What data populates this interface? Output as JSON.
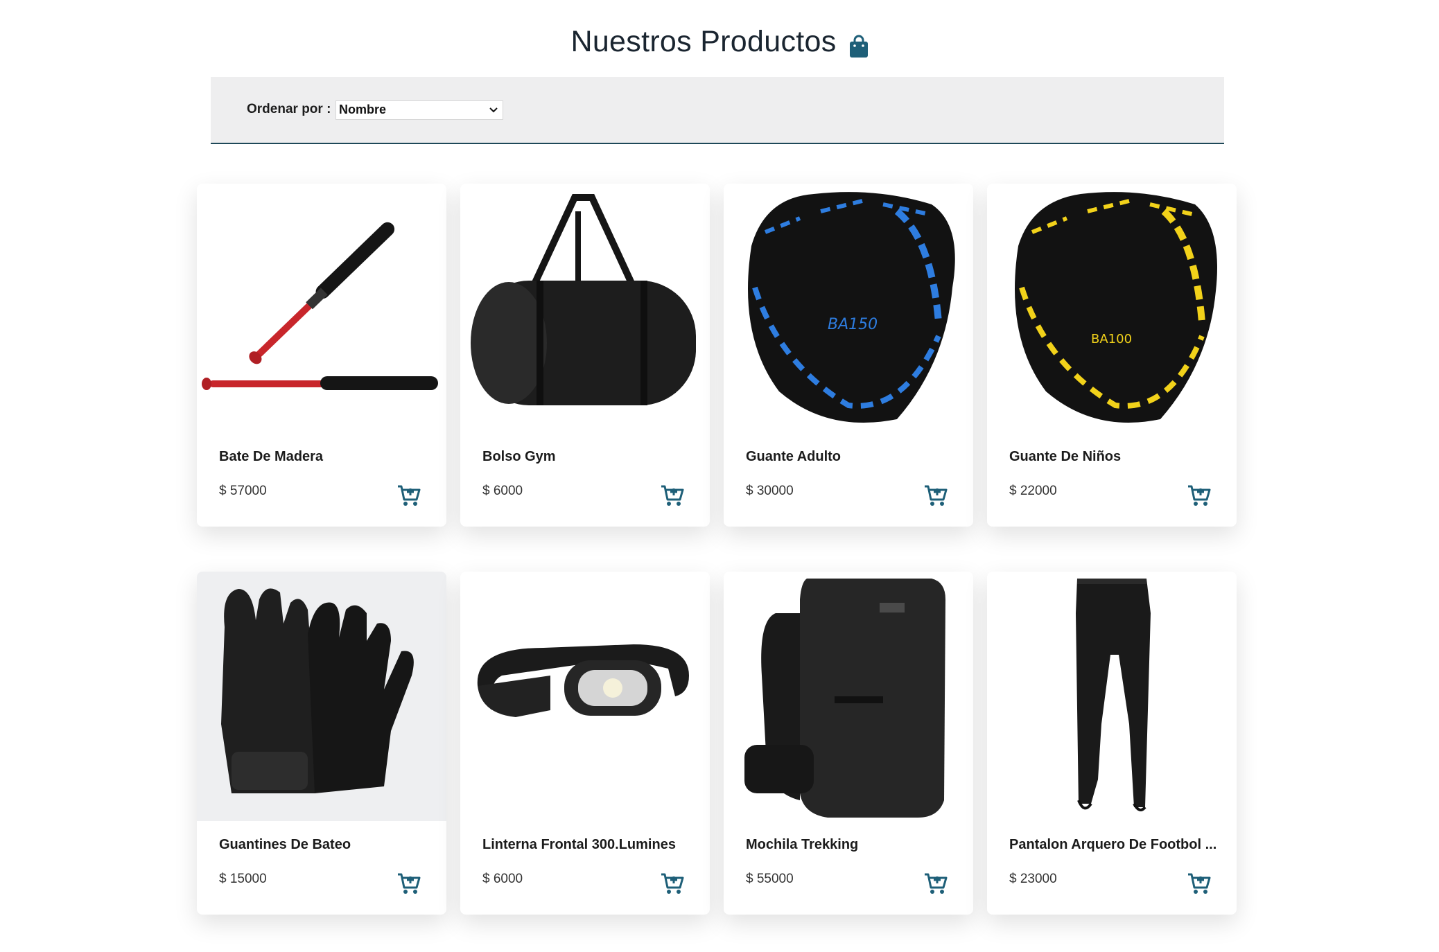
{
  "header": {
    "title": "Nuestros Productos",
    "icon": "shopping-bag-icon"
  },
  "filter": {
    "label": "Ordenar por :",
    "selected": "Nombre"
  },
  "colors": {
    "accent": "#1e5f78",
    "filter_bg": "#eeeeef",
    "filter_border": "#1e4858"
  },
  "products": [
    {
      "name": "Bate De Madera",
      "price": "$ 57000",
      "image": "baseball-bat-image"
    },
    {
      "name": "Bolso Gym",
      "price": "$ 6000",
      "image": "gym-bag-image"
    },
    {
      "name": "Guante Adulto",
      "price": "$ 30000",
      "image": "blue-baseball-glove-image"
    },
    {
      "name": "Guante De Niños",
      "price": "$ 22000",
      "image": "yellow-baseball-glove-image"
    },
    {
      "name": "Guantines De Bateo",
      "price": "$ 15000",
      "image": "batting-gloves-image"
    },
    {
      "name": "Linterna Frontal 300.Lumines",
      "price": "$ 6000",
      "image": "headlamp-image"
    },
    {
      "name": "Mochila Trekking",
      "price": "$ 55000",
      "image": "trekking-backpack-image"
    },
    {
      "name": "Pantalon Arquero De Footbol ...",
      "price": "$ 23000",
      "image": "goalkeeper-pants-image"
    }
  ]
}
